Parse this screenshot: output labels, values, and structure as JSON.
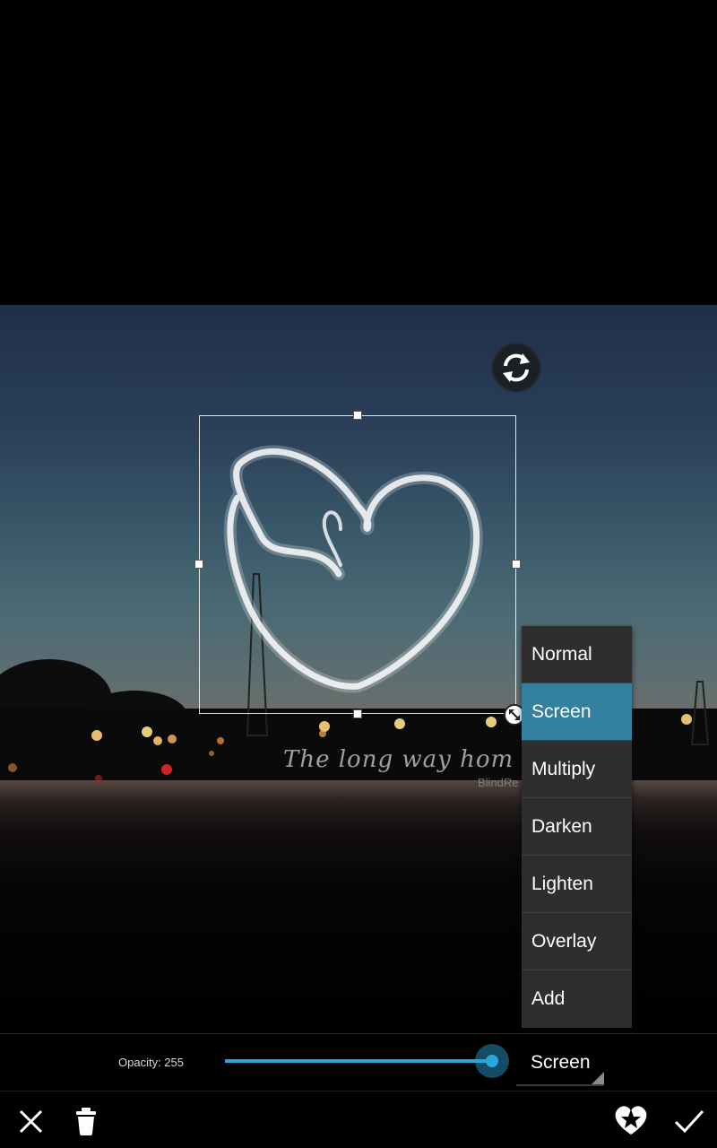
{
  "photo": {
    "watermark_title": "The long way hom",
    "watermark_credit": "BlindRe"
  },
  "editor": {
    "rotate_icon": "rotate-icon",
    "resize_icon": "resize-icon"
  },
  "blend_menu": {
    "items": [
      "Normal",
      "Screen",
      "Multiply",
      "Darken",
      "Lighten",
      "Overlay",
      "Add"
    ],
    "selected": "Screen",
    "accent_color": "#33809f"
  },
  "opacity": {
    "label": "Opacity: 255",
    "value": 255,
    "max": 255,
    "accent_color": "#2aa8de"
  },
  "blend_spinner": {
    "value": "Screen"
  },
  "toolbar": {
    "cancel_icon": "close-icon",
    "delete_icon": "trash-icon",
    "sticker_icon": "heart-star-icon",
    "apply_icon": "check-icon"
  }
}
